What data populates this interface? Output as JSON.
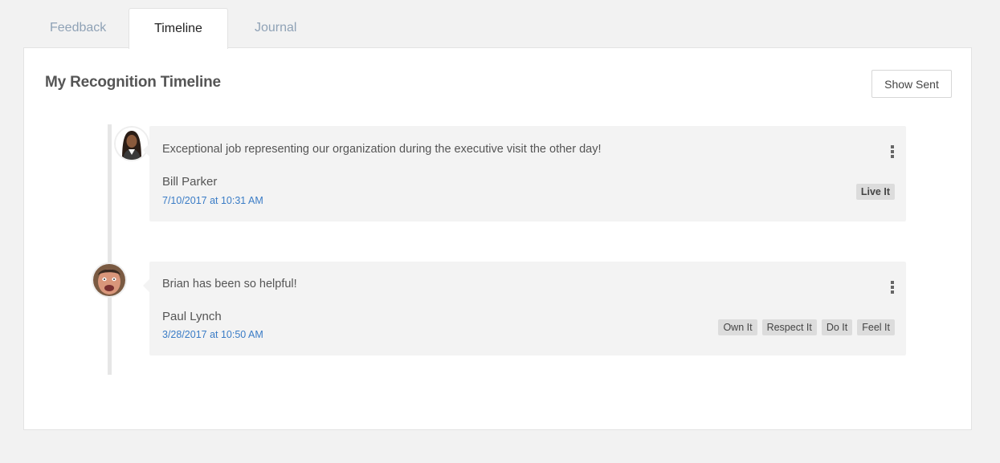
{
  "tabs": [
    {
      "label": "Feedback",
      "active": false
    },
    {
      "label": "Timeline",
      "active": true
    },
    {
      "label": "Journal",
      "active": false
    }
  ],
  "panel": {
    "title": "My Recognition Timeline",
    "show_sent_label": "Show Sent"
  },
  "entries": [
    {
      "message": "Exceptional job representing our organization during the executive visit the other day!",
      "author": "Bill Parker",
      "date": "7/10/2017 at 10:31 AM",
      "tags": [
        "Live It"
      ],
      "avatar": "woman-avatar"
    },
    {
      "message": "Brian has been so helpful!",
      "author": "Paul Lynch",
      "date": "3/28/2017 at 10:50 AM",
      "tags": [
        "Own It",
        "Respect It",
        "Do It",
        "Feel It"
      ],
      "avatar": "man-avatar"
    }
  ],
  "colors": {
    "background": "#f2f2f2",
    "card": "#f3f3f3",
    "date_link": "#3a7cc6",
    "tag": "#dcdcdc",
    "inactive_tab": "#8fa2b6"
  }
}
